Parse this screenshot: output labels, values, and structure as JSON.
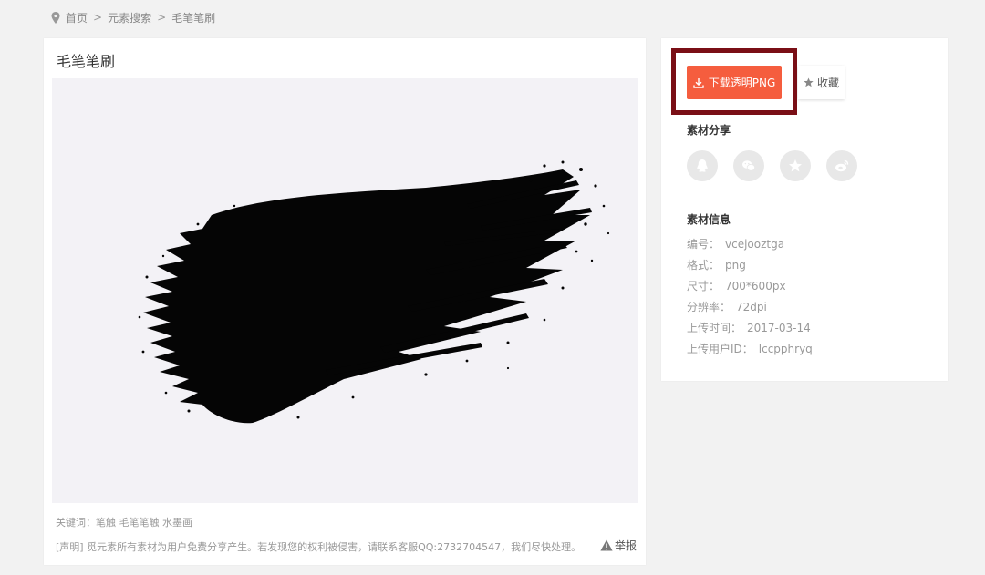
{
  "breadcrumb": {
    "home": "首页",
    "separator": ">",
    "search": "元素搜索",
    "current": "毛笔笔刷"
  },
  "detail": {
    "title": "毛笔笔刷",
    "keywords_label": "关键词：",
    "keywords": [
      "笔触",
      "毛笔笔触",
      "水墨画"
    ],
    "statement": "[声明] 觅元素所有素材为用户免费分享产生。若发现您的权利被侵害，请联系客服QQ:2732704547，我们尽快处理。",
    "report_label": "举报"
  },
  "actions": {
    "download_label": "下载透明PNG",
    "favorite_label": "收藏",
    "accent_color": "#f55d3e",
    "highlight_color": "#7a0f16"
  },
  "share": {
    "title": "素材分享",
    "icons": [
      "qq-icon",
      "wechat-icon",
      "qzone-icon",
      "weibo-icon"
    ]
  },
  "info": {
    "title": "素材信息",
    "rows": [
      {
        "label": "编号：",
        "value": "vcejooztga"
      },
      {
        "label": "格式：",
        "value": "png"
      },
      {
        "label": "尺寸：",
        "value": "700*600px"
      },
      {
        "label": "分辨率：",
        "value": "72dpi"
      },
      {
        "label": "上传时间：",
        "value": "2017-03-14"
      },
      {
        "label": "上传用户ID：",
        "value": "lccpphryq"
      }
    ]
  }
}
